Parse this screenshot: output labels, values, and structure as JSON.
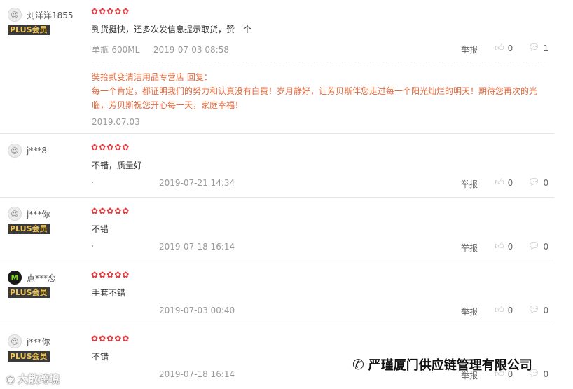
{
  "star_glyph": "✿",
  "reviews": [
    {
      "username": "刘洋洋1855",
      "plus": "PLUS会员",
      "content": "到货挺快，还多次发信息提示取货，赞一个",
      "product": "单瓶-600ML",
      "date": "2019-07-03 08:58",
      "report": "举报",
      "likes": "0",
      "replies": "1",
      "shop_reply": {
        "header": "奘拾贰变清洁用品专营店 回复：",
        "text_line1": "每一个肯定，都证明我们的努力和认真没有白费！岁月静好，让芳贝斯伴您走过每一个阳光灿烂的明天！期待您再次的光",
        "text_line2": "临，芳贝斯祝您开心每一天，家庭幸福！",
        "date": "2019.07.03"
      }
    },
    {
      "username": "j***8",
      "plus": "",
      "content": "不错，质量好",
      "product": "",
      "date": "2019-07-21 14:34",
      "report": "举报",
      "likes": "0",
      "replies": "0"
    },
    {
      "username": "j***你",
      "plus": "PLUS会员",
      "content": "不错",
      "product": "",
      "date": "2019-07-18 16:14",
      "report": "举报",
      "likes": "0",
      "replies": "0"
    },
    {
      "username": "点***恋",
      "plus": "PLUS会员",
      "content": "手套不错",
      "product": "",
      "date": "2019-07-03 00:40",
      "report": "举报",
      "likes": "0",
      "replies": "0"
    },
    {
      "username": "j***你",
      "plus": "PLUS会员",
      "content": "不错",
      "product": "",
      "date": "2019-07-18 16:14",
      "report": "举报",
      "likes": "0",
      "replies": "0"
    }
  ],
  "watermark": {
    "left": "大散跨境",
    "right": "严瑾厦门供应链管理有限公司"
  }
}
